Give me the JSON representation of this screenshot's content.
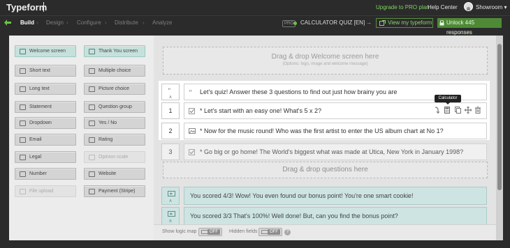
{
  "app": {
    "brand": "Typeform",
    "upgrade_link": "Upgrade to PRO plan",
    "help_link": "Help Center",
    "user": "Showroom",
    "user_caret": "▾"
  },
  "nav": {
    "tabs": [
      "Build",
      "Design",
      "Configure",
      "Distribute",
      "Analyze"
    ],
    "active_tab": "Build",
    "pro_tag": "PRO",
    "form_title": "CALCULATOR QUIZ [EN]",
    "edit_arrow": "→",
    "view_button": "View my typeform",
    "unlock_button": "Unlock 445 responses"
  },
  "sidebar": {
    "items": [
      {
        "label": "Welcome screen",
        "icon": "welcome-icon",
        "style": "teal"
      },
      {
        "label": "Thank You screen",
        "icon": "thankyou-icon",
        "style": "teal"
      },
      {
        "label": "Short text",
        "icon": "short-text-icon"
      },
      {
        "label": "Multiple choice",
        "icon": "multiple-choice-icon"
      },
      {
        "label": "Long text",
        "icon": "long-text-icon"
      },
      {
        "label": "Picture choice",
        "icon": "picture-choice-icon"
      },
      {
        "label": "Statement",
        "icon": "statement-icon"
      },
      {
        "label": "Question group",
        "icon": "question-group-icon"
      },
      {
        "label": "Dropdown",
        "icon": "dropdown-icon"
      },
      {
        "label": "Yes / No",
        "icon": "yes-no-icon"
      },
      {
        "label": "Email",
        "icon": "email-icon"
      },
      {
        "label": "Rating",
        "icon": "rating-icon"
      },
      {
        "label": "Legal",
        "icon": "legal-icon"
      },
      {
        "label": "Opinion scale",
        "icon": "opinion-scale-icon",
        "style": "disabled"
      },
      {
        "label": "Number",
        "icon": "number-icon"
      },
      {
        "label": "Website",
        "icon": "website-icon"
      },
      {
        "label": "File upload",
        "icon": "file-upload-icon",
        "style": "disabled"
      },
      {
        "label": "Payment (Stripe)",
        "icon": "payment-icon"
      }
    ]
  },
  "canvas": {
    "welcome_drop": "Drag & drop Welcome screen here",
    "welcome_drop_sub": "(Options: logo, image and welcome message)",
    "questions": [
      {
        "num": "",
        "sub": "A",
        "icon": "statement-icon",
        "text": "Let's quiz! Answer these 3 questions to find out just how brainy you are"
      },
      {
        "num": "1",
        "sub": "",
        "icon": "check-icon",
        "text": "* Let's start with an easy one! What's 5 x 2?"
      },
      {
        "num": "2",
        "sub": "",
        "icon": "picture-choice-icon",
        "text": "* Now for the music round! Who was the first artist to enter the US album chart at No 1?"
      },
      {
        "num": "3",
        "sub": "",
        "icon": "check-icon",
        "text": "* Go big or go home! The World's biggest what was made at Utica, New York in January 1998?"
      }
    ],
    "tooltip": "Calculator",
    "question_drop": "Drag & drop questions here",
    "endings": [
      {
        "sub": "A",
        "text": "You scored 4/3! Wow! You even found our bonus point! You're one smart cookie!"
      },
      {
        "sub": "B",
        "text": "You scored 3/3 That's 100%! Well done! But, can you find the bonus point?"
      }
    ]
  },
  "bottombar": {
    "logic_label": "Show logic map",
    "logic_state": "OFF",
    "hidden_label": "Hidden fields",
    "hidden_state": "OFF",
    "help": "?"
  },
  "colors": {
    "accent_green": "#6cc24a",
    "teal_panel": "#cde4e2",
    "dark_bar": "#2b2b2b"
  }
}
